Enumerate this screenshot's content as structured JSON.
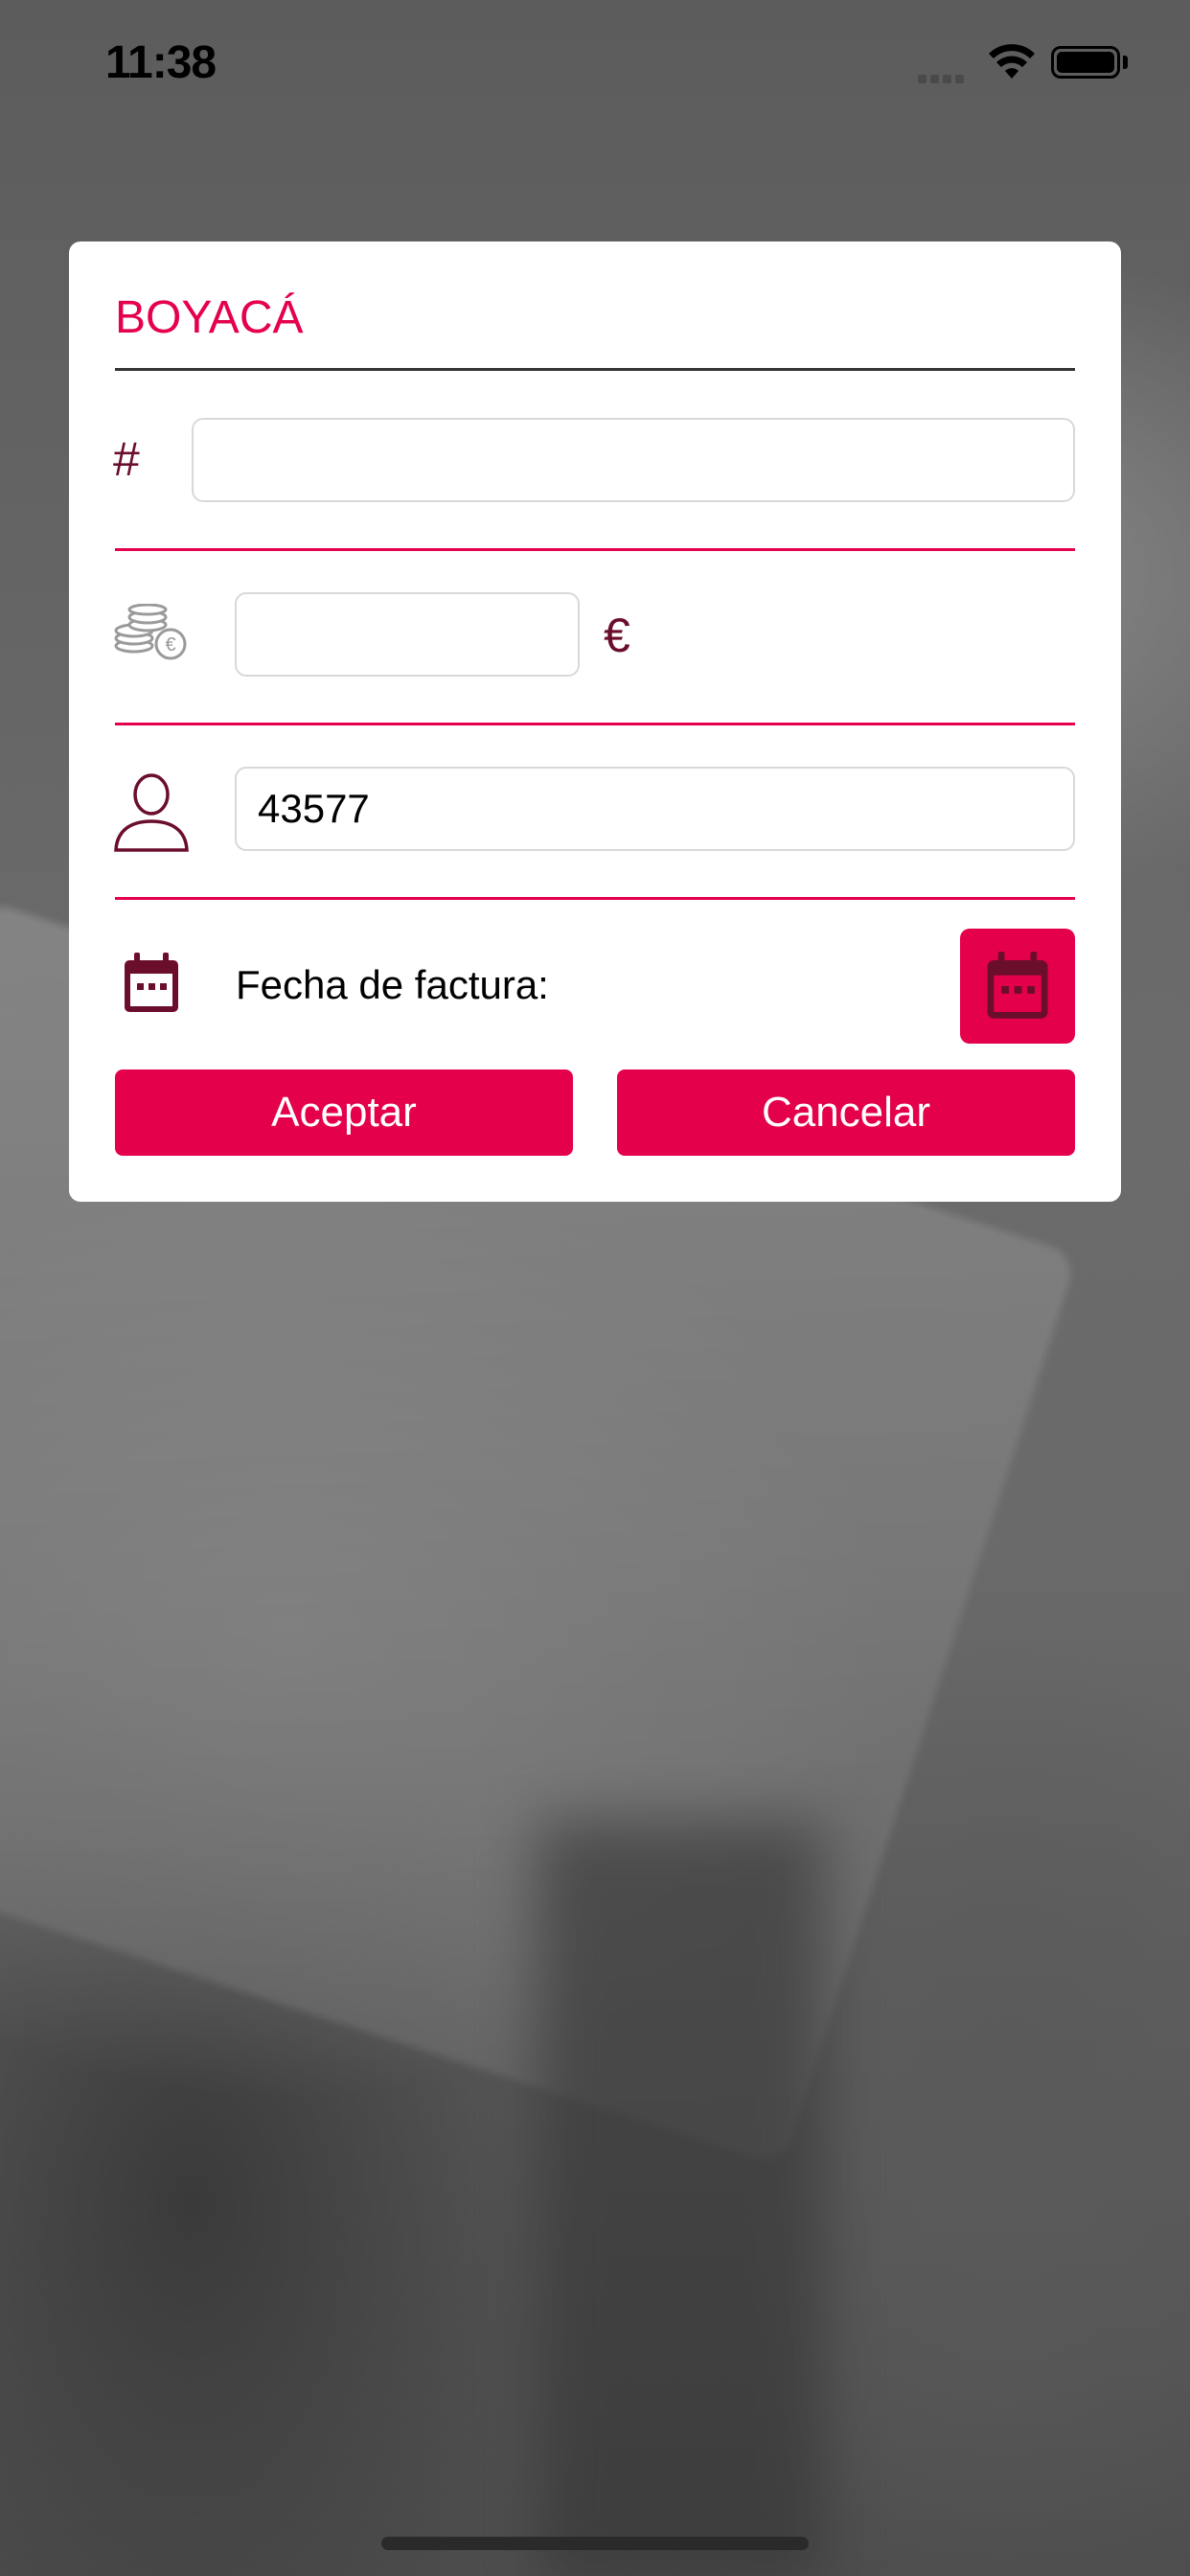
{
  "status_bar": {
    "time": "11:38"
  },
  "dialog": {
    "title": "BOYACÁ",
    "number_field": {
      "icon": "hash",
      "label": "#",
      "value": ""
    },
    "amount_field": {
      "icon": "coins-euro-icon",
      "value": "",
      "currency": "€"
    },
    "user_field": {
      "icon": "user-icon",
      "value": "43577"
    },
    "date_row": {
      "icon": "calendar-icon",
      "label": "Fecha de factura:",
      "button_icon": "calendar-icon"
    },
    "accept_label": "Aceptar",
    "cancel_label": "Cancelar"
  },
  "colors": {
    "accent": "#e4004b",
    "dark_accent": "#6b0e2b"
  }
}
